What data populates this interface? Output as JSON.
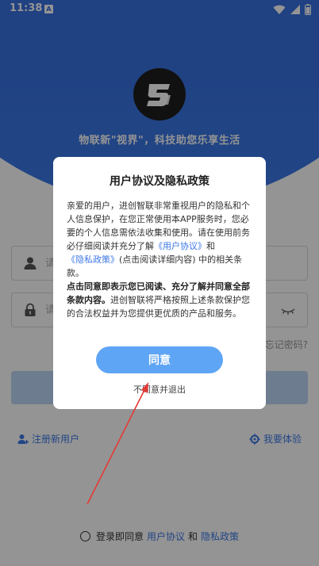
{
  "status_bar": {
    "time": "11:38",
    "notification_letter": "A"
  },
  "brand": {
    "slogan": "物联新\"视界\"，科技助您乐享生活"
  },
  "login_form": {
    "username_placeholder": "请",
    "password_placeholder": "请",
    "forgot_password": "忘记密码?",
    "login_button_label": ""
  },
  "links": {
    "register": "注册新用户",
    "trial": "我要体验"
  },
  "footer": {
    "agree_prefix": "登录即同意",
    "user_agreement": "用户协议",
    "and": "和",
    "privacy_policy": "隐私政策"
  },
  "dialog": {
    "title": "用户协议及隐私政策",
    "p1": "亲爱的用户，进创智联非常重视用户的隐私和个人信息保护，在您正常使用本APP服务时，您必要的个人信息需依法收集和使用。请在使用前务必仔细阅读并充分了解",
    "link_user_agreement": "《用户协议》",
    "and": "和",
    "link_privacy_policy": "《隐私政策》",
    "p1_tail": "(点击阅读详细内容) 中的相关条款。",
    "bold_text": "点击同意即表示您已阅读、充分了解并同意全部条款内容。",
    "p2_tail": "进创智联将严格按照上述条款保护您的合法权益并为您提供更优质的产品和服务。",
    "agree_button": "同意",
    "disagree_link": "不同意并退出"
  },
  "colors": {
    "brand_blue": "#3b78e6",
    "agree_button": "#5fa5f5",
    "annotation_red": "#e53935"
  }
}
